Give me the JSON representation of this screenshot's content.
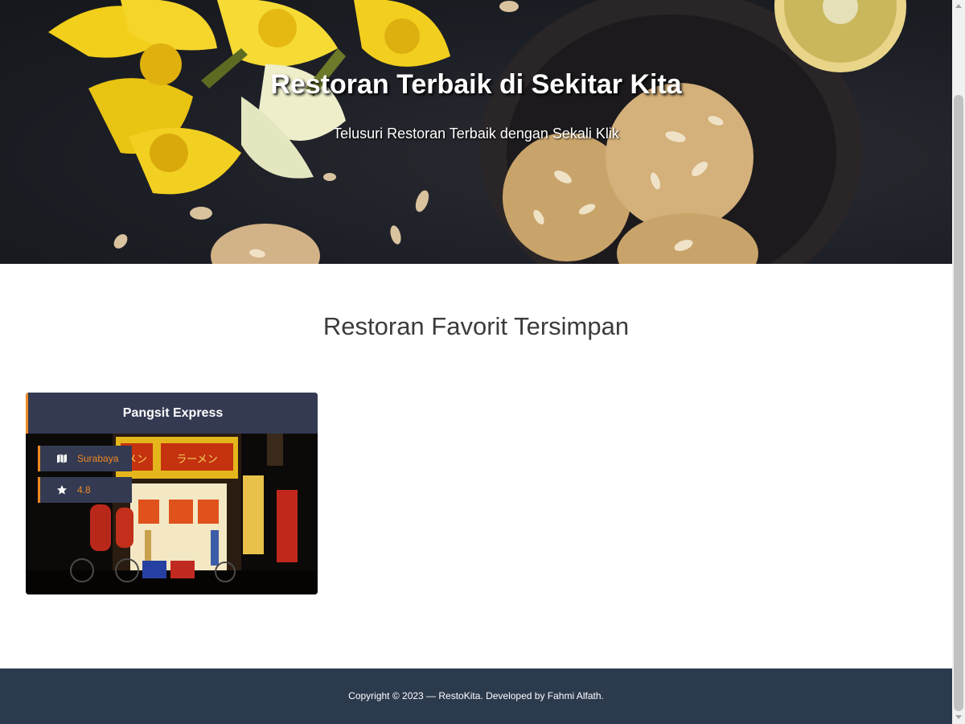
{
  "hero": {
    "title": "Restoran Terbaik di Sekitar Kita",
    "subtitle": "Telusuri Restoran Terbaik dengan Sekali Klik"
  },
  "favorites": {
    "heading": "Restoran Favorit Tersimpan",
    "restaurants": [
      {
        "name": "Pangsit Express",
        "city": "Surabaya",
        "rating": "4.8",
        "city_icon": "map-icon",
        "rating_icon": "star-icon",
        "image_signs": [
          "メン",
          "ラーメン"
        ]
      }
    ]
  },
  "footer": {
    "copyright": "Copyright © 2023 — RestoKita. Developed by Fahmi Alfath."
  },
  "colors": {
    "accent": "#f08a24",
    "card_header": "#343a52",
    "footer_bg": "#2c3a4e",
    "heading_text": "#3c3c3c"
  }
}
